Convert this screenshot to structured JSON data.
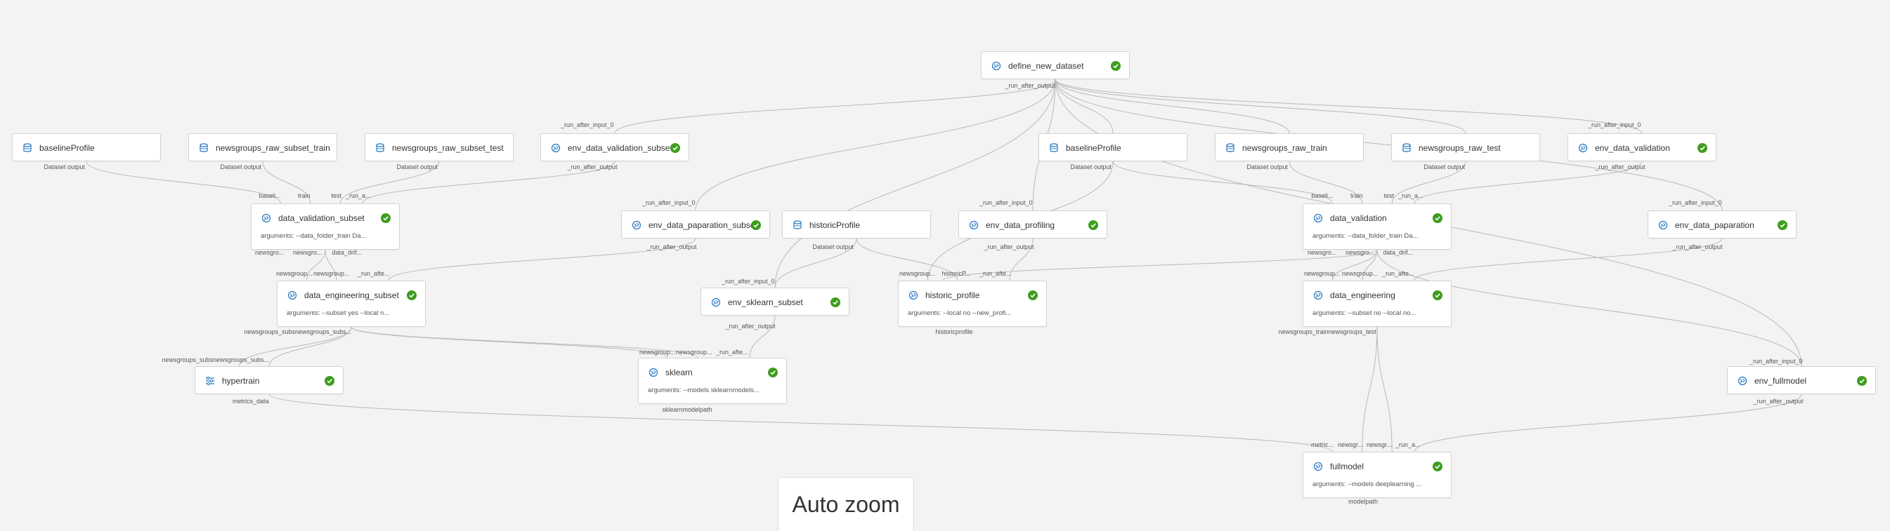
{
  "nodes": [
    {
      "id": "define_new_dataset",
      "title": "define_new_dataset",
      "kind": "component",
      "status": "succeeded"
    },
    {
      "id": "baselineProfile_l",
      "title": "baselineProfile",
      "kind": "dataset"
    },
    {
      "id": "newsgroups_raw_subset_train",
      "title": "newsgroups_raw_subset_train",
      "kind": "dataset"
    },
    {
      "id": "newsgroups_raw_subset_test",
      "title": "newsgroups_raw_subset_test",
      "kind": "dataset"
    },
    {
      "id": "env_data_validation_subset",
      "title": "env_data_validation_subset",
      "kind": "component",
      "status": "succeeded"
    },
    {
      "id": "baselineProfile_r",
      "title": "baselineProfile",
      "kind": "dataset"
    },
    {
      "id": "newsgroups_raw_train",
      "title": "newsgroups_raw_train",
      "kind": "dataset"
    },
    {
      "id": "newsgroups_raw_test",
      "title": "newsgroups_raw_test",
      "kind": "dataset"
    },
    {
      "id": "env_data_validation",
      "title": "env_data_validation",
      "kind": "component",
      "status": "succeeded"
    },
    {
      "id": "data_validation_subset",
      "title": "data_validation_subset",
      "kind": "component",
      "status": "succeeded",
      "args": "arguments: --data_folder_train Da..."
    },
    {
      "id": "env_data_paparation_subset",
      "title": "env_data_paparation_subset",
      "kind": "component",
      "status": "succeeded"
    },
    {
      "id": "historicProfile",
      "title": "historicProfile",
      "kind": "dataset"
    },
    {
      "id": "env_data_profiling",
      "title": "env_data_profiling",
      "kind": "component",
      "status": "succeeded"
    },
    {
      "id": "data_validation",
      "title": "data_validation",
      "kind": "component",
      "status": "succeeded",
      "args": "arguments: --data_folder_train Da..."
    },
    {
      "id": "env_data_paparation",
      "title": "env_data_paparation",
      "kind": "component",
      "status": "succeeded"
    },
    {
      "id": "data_engineering_subset",
      "title": "data_engineering_subset",
      "kind": "component",
      "status": "succeeded",
      "args": "arguments: --subset yes --local n..."
    },
    {
      "id": "env_sklearn_subset",
      "title": "env_sklearn_subset",
      "kind": "component",
      "status": "succeeded"
    },
    {
      "id": "historic_profile",
      "title": "historic_profile",
      "kind": "component",
      "status": "succeeded",
      "args": "arguments: --local no --new_profi..."
    },
    {
      "id": "data_engineering",
      "title": "data_engineering",
      "kind": "component",
      "status": "succeeded",
      "args": "arguments: --subset no --local no..."
    },
    {
      "id": "hypertrain",
      "title": "hypertrain",
      "kind": "sweep",
      "status": "succeeded"
    },
    {
      "id": "sklearn",
      "title": "sklearn",
      "kind": "component",
      "status": "succeeded",
      "args": "arguments: --models sklearnmodels..."
    },
    {
      "id": "env_fullmodel",
      "title": "env_fullmodel",
      "kind": "component",
      "status": "succeeded"
    },
    {
      "id": "fullmodel",
      "title": "fullmodel",
      "kind": "component",
      "status": "succeeded",
      "args": "arguments: --models deeplearning ..."
    }
  ],
  "port_labels": [
    "_run_after_output",
    "_run_after_input_0",
    "_run_after_input_0",
    "Dataset output",
    "Dataset output",
    "Dataset output",
    "_run_after_output",
    "Dataset output",
    "Dataset output",
    "Dataset output",
    "_run_after_output",
    "baseli...",
    "train",
    "test",
    "_run_a...",
    "baseli...",
    "train",
    "test",
    "_run_a...",
    "_run_after_input_0",
    "_run_after_input_0",
    "_run_after_input_0",
    "newsgro...",
    "newsgro...",
    "data_drif...",
    "newsgro...",
    "newsgro...",
    "data_drif...",
    "_run_after_output",
    "Dataset output",
    "_run_after_output",
    "_run_after_output",
    "newsgroup...",
    "newsgroup...",
    "_run_afte...",
    "newsgroup...",
    "historicP...",
    "_run_afte...",
    "newsgroup...",
    "newsgroup...",
    "_run_afte...",
    "_run_after_input_0",
    "newsgroups_subsnewsgroups_subs...",
    "historicprofile",
    "newsgroups_trainnewsgroups_test",
    "_run_after_output",
    "newsgroups_subsnewsgroups_subs...",
    "newsgroup...",
    "newsgroup...",
    "_run_afte...",
    "_run_after_input_0",
    "metrics_data",
    "sklearnmodelpath",
    "_run_after_output",
    "metric...",
    "newsgr...",
    "newsgr...",
    "_run_a...",
    "modelpath"
  ],
  "toolbar": {
    "auto_zoom_label": "Auto zoom"
  },
  "colors": {
    "canvas": "#f3f3f3",
    "node_border": "#d2d2d2",
    "edge": "#b8b8b8",
    "icon": "#2577c2",
    "success": "#3f9c1f"
  }
}
